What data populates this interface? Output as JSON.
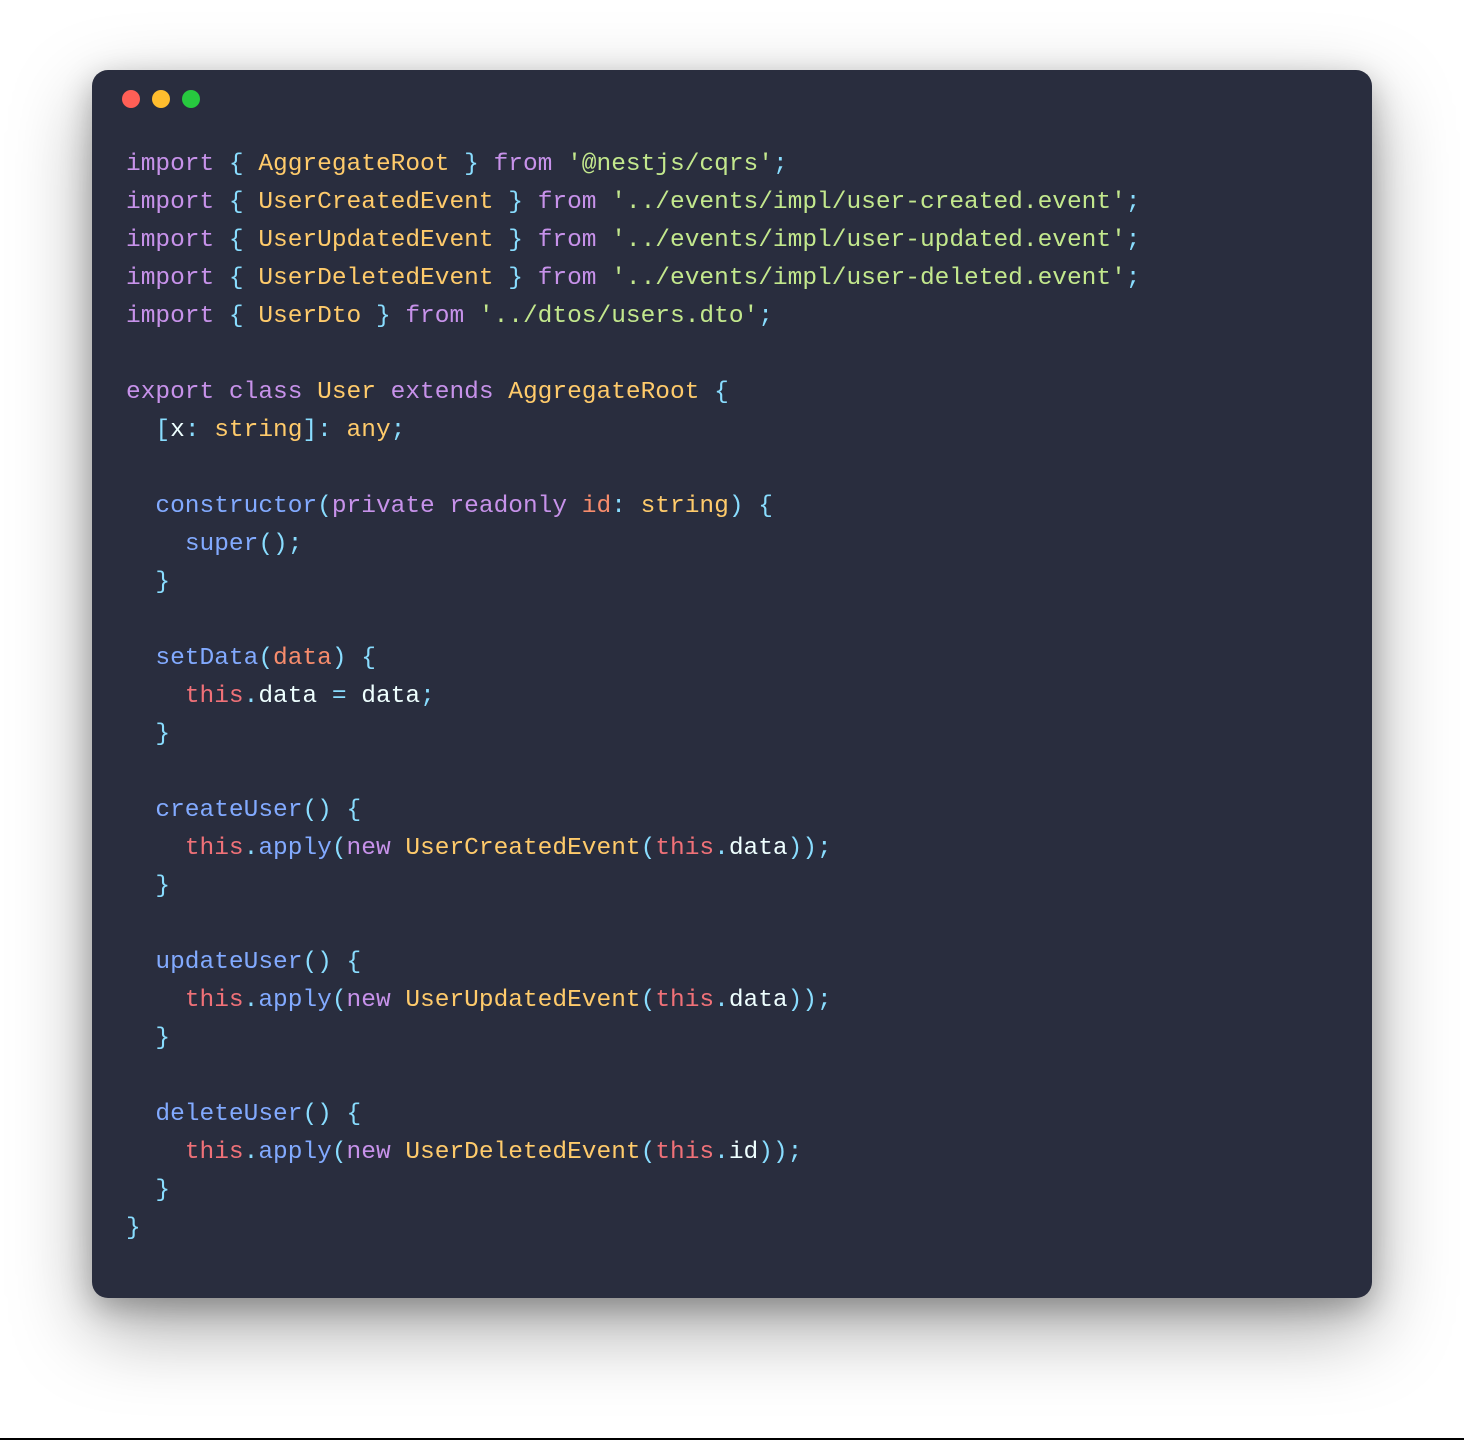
{
  "traffic_lights": {
    "red": "#ff5f56",
    "yellow": "#ffbd2e",
    "green": "#27c93f"
  },
  "theme": {
    "bg": "#292d3e",
    "fg": "#eeffff",
    "keyword": "#c792ea",
    "punct": "#89ddff",
    "type": "#ffcb6b",
    "string": "#c3e88d",
    "fn": "#82aaff",
    "attr": "#f07178",
    "orange": "#f78c6c"
  },
  "code": {
    "imports": [
      {
        "kw_import": "import",
        "brace_open": "{",
        "name": "AggregateRoot",
        "brace_close": "}",
        "kw_from": "from",
        "path": "'@nestjs/cqrs'",
        "semi": ";"
      },
      {
        "kw_import": "import",
        "brace_open": "{",
        "name": "UserCreatedEvent",
        "brace_close": "}",
        "kw_from": "from",
        "path": "'../events/impl/user-created.event'",
        "semi": ";"
      },
      {
        "kw_import": "import",
        "brace_open": "{",
        "name": "UserUpdatedEvent",
        "brace_close": "}",
        "kw_from": "from",
        "path": "'../events/impl/user-updated.event'",
        "semi": ";"
      },
      {
        "kw_import": "import",
        "brace_open": "{",
        "name": "UserDeletedEvent",
        "brace_close": "}",
        "kw_from": "from",
        "path": "'../events/impl/user-deleted.event'",
        "semi": ";"
      },
      {
        "kw_import": "import",
        "brace_open": "{",
        "name": "UserDto",
        "brace_close": "}",
        "kw_from": "from",
        "path": "'../dtos/users.dto'",
        "semi": ";"
      }
    ],
    "class": {
      "kw_export": "export",
      "kw_class": "class",
      "name": "User",
      "kw_extends": "extends",
      "super": "AggregateRoot",
      "brace_open": "{",
      "index_sig": {
        "open": "[",
        "x": "x",
        "colon": ":",
        "str_t": "string",
        "close": "]",
        "colon2": ":",
        "any_t": "any",
        "semi": ";"
      },
      "constructor": {
        "kw": "constructor",
        "open": "(",
        "kw_private": "private",
        "kw_readonly": "readonly",
        "param": "id",
        "colon": ":",
        "type": "string",
        "close": ")",
        "brace_open": "{",
        "super_call": "super",
        "paren_open": "(",
        "paren_close": ")",
        "semi": ";",
        "brace_close": "}"
      },
      "setData": {
        "name": "setData",
        "open": "(",
        "param": "data",
        "close": ")",
        "brace_open": "{",
        "this": "this",
        "dot": ".",
        "prop": "data",
        "eq": "=",
        "val": "data",
        "semi": ";",
        "brace_close": "}"
      },
      "createUser": {
        "name": "createUser",
        "open": "(",
        "close": ")",
        "brace_open": "{",
        "this": "this",
        "dot": ".",
        "apply": "apply",
        "open2": "(",
        "kw_new": "new",
        "evt": "UserCreatedEvent",
        "open3": "(",
        "this2": "this",
        "dot2": ".",
        "arg": "data",
        "close3": ")",
        "close2": ")",
        "semi": ";",
        "brace_close": "}"
      },
      "updateUser": {
        "name": "updateUser",
        "open": "(",
        "close": ")",
        "brace_open": "{",
        "this": "this",
        "dot": ".",
        "apply": "apply",
        "open2": "(",
        "kw_new": "new",
        "evt": "UserUpdatedEvent",
        "open3": "(",
        "this2": "this",
        "dot2": ".",
        "arg": "data",
        "close3": ")",
        "close2": ")",
        "semi": ";",
        "brace_close": "}"
      },
      "deleteUser": {
        "name": "deleteUser",
        "open": "(",
        "close": ")",
        "brace_open": "{",
        "this": "this",
        "dot": ".",
        "apply": "apply",
        "open2": "(",
        "kw_new": "new",
        "evt": "UserDeletedEvent",
        "open3": "(",
        "this2": "this",
        "dot2": ".",
        "arg": "id",
        "close3": ")",
        "close2": ")",
        "semi": ";",
        "brace_close": "}"
      },
      "brace_close": "}"
    }
  }
}
